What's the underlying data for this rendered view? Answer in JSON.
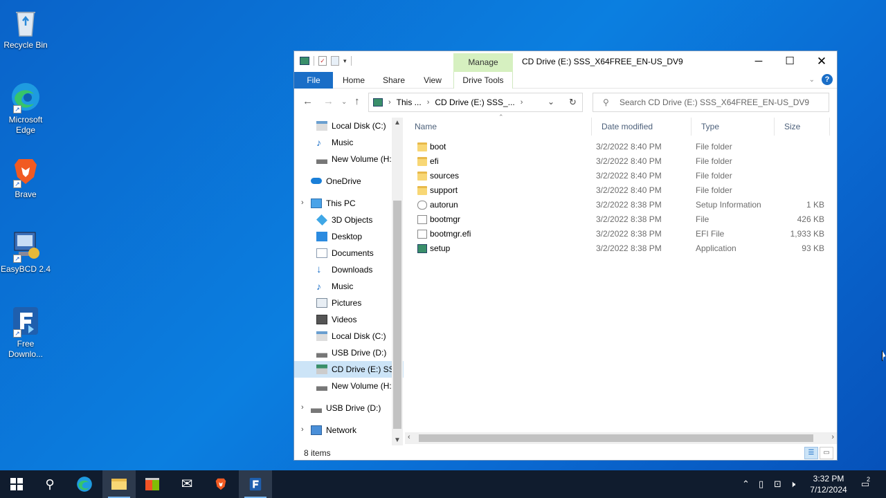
{
  "desktop": {
    "icons": [
      {
        "label": "Recycle Bin",
        "icon": "recycle-bin-icon"
      },
      {
        "label": "Microsoft Edge",
        "icon": "edge-icon"
      },
      {
        "label": "Brave",
        "icon": "brave-icon"
      },
      {
        "label": "EasyBCD 2.4",
        "icon": "easybcd-icon"
      },
      {
        "label": "Free Downlo...",
        "icon": "free-download-icon"
      }
    ]
  },
  "window": {
    "title": "CD Drive (E:) SSS_X64FREE_EN-US_DV9",
    "manage_tab": "Manage",
    "ribbon_tabs": [
      "File",
      "Home",
      "Share",
      "View",
      "Drive Tools"
    ],
    "address": {
      "segments": [
        "This ...",
        "CD Drive (E:) SSS_..."
      ]
    },
    "search_placeholder": "Search CD Drive (E:) SSS_X64FREE_EN-US_DV9",
    "nav_items": [
      {
        "label": "Local Disk (C:)",
        "icon": "drive-icon"
      },
      {
        "label": "Music",
        "icon": "music-icon"
      },
      {
        "label": "New Volume (H:",
        "icon": "drive-icon"
      },
      {
        "label": "OneDrive",
        "icon": "cloud-icon"
      },
      {
        "label": "This PC",
        "icon": "pc-icon"
      },
      {
        "label": "3D Objects",
        "icon": "cube-icon"
      },
      {
        "label": "Desktop",
        "icon": "desktop-icon"
      },
      {
        "label": "Documents",
        "icon": "documents-icon"
      },
      {
        "label": "Downloads",
        "icon": "download-icon"
      },
      {
        "label": "Music",
        "icon": "music-icon"
      },
      {
        "label": "Pictures",
        "icon": "pictures-icon"
      },
      {
        "label": "Videos",
        "icon": "videos-icon"
      },
      {
        "label": "Local Disk (C:)",
        "icon": "drive-icon"
      },
      {
        "label": "USB Drive (D:)",
        "icon": "usb-icon"
      },
      {
        "label": "CD Drive (E:) SSS",
        "icon": "cd-drive-icon"
      },
      {
        "label": "New Volume (H:",
        "icon": "drive-icon"
      },
      {
        "label": "USB Drive (D:)",
        "icon": "usb-icon"
      },
      {
        "label": "Network",
        "icon": "network-icon"
      }
    ],
    "columns": [
      "Name",
      "Date modified",
      "Type",
      "Size"
    ],
    "files": [
      {
        "name": "boot",
        "date": "3/2/2022 8:40 PM",
        "type": "File folder",
        "size": "",
        "kind": "folder"
      },
      {
        "name": "efi",
        "date": "3/2/2022 8:40 PM",
        "type": "File folder",
        "size": "",
        "kind": "folder"
      },
      {
        "name": "sources",
        "date": "3/2/2022 8:40 PM",
        "type": "File folder",
        "size": "",
        "kind": "folder"
      },
      {
        "name": "support",
        "date": "3/2/2022 8:40 PM",
        "type": "File folder",
        "size": "",
        "kind": "folder"
      },
      {
        "name": "autorun",
        "date": "3/2/2022 8:38 PM",
        "type": "Setup Information",
        "size": "1 KB",
        "kind": "setup-info"
      },
      {
        "name": "bootmgr",
        "date": "3/2/2022 8:38 PM",
        "type": "File",
        "size": "426 KB",
        "kind": "file"
      },
      {
        "name": "bootmgr.efi",
        "date": "3/2/2022 8:38 PM",
        "type": "EFI File",
        "size": "1,933 KB",
        "kind": "file"
      },
      {
        "name": "setup",
        "date": "3/2/2022 8:38 PM",
        "type": "Application",
        "size": "93 KB",
        "kind": "application"
      }
    ],
    "status": "8 items"
  },
  "taskbar": {
    "time": "3:32 PM",
    "date": "7/12/2024",
    "notification_count": "2"
  },
  "colors": {
    "desktop": "#0b78d7",
    "accent": "#1a6ec7",
    "manage_tab": "#d6f0c0",
    "selection": "#cce4f7",
    "taskbar": "#101c2e"
  }
}
